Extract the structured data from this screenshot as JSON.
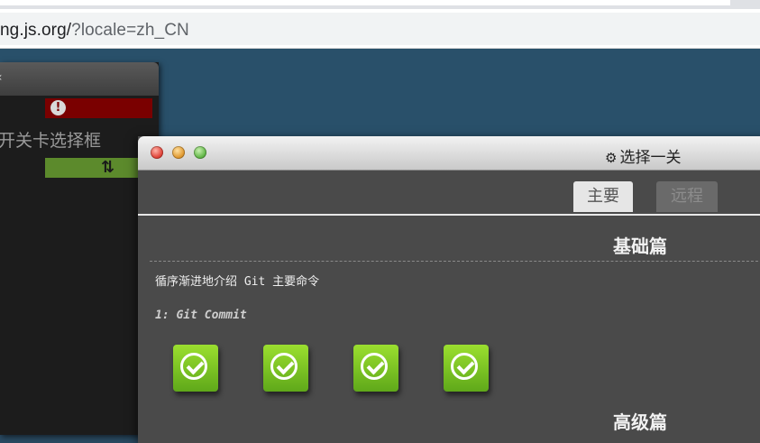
{
  "browser": {
    "url_main": "ng.js.org/",
    "url_query": "?locale=zh_CN"
  },
  "back_window": {
    "title_fragment": "«",
    "alert_icon": "exclamation-circle-icon",
    "label": "开关卡选择框",
    "swap_icon": "swap-arrows-icon"
  },
  "dialog": {
    "title": "选择一关",
    "title_icon": "gear-icon",
    "tabs": [
      {
        "label": "主要",
        "active": true
      },
      {
        "label": "远程",
        "active": false
      }
    ],
    "sections": [
      {
        "title": "基础篇",
        "description": "循序渐进地介绍 Git 主要命令",
        "subheading": "1: Git Commit",
        "levels": [
          {
            "status": "completed"
          },
          {
            "status": "completed"
          },
          {
            "status": "completed"
          },
          {
            "status": "completed"
          }
        ]
      },
      {
        "title": "高级篇"
      }
    ]
  },
  "colors": {
    "page_background": "#29506a",
    "error_bar": "#7a0000",
    "success_bar": "#5c8a2c",
    "level_completed": "#7cc925"
  }
}
